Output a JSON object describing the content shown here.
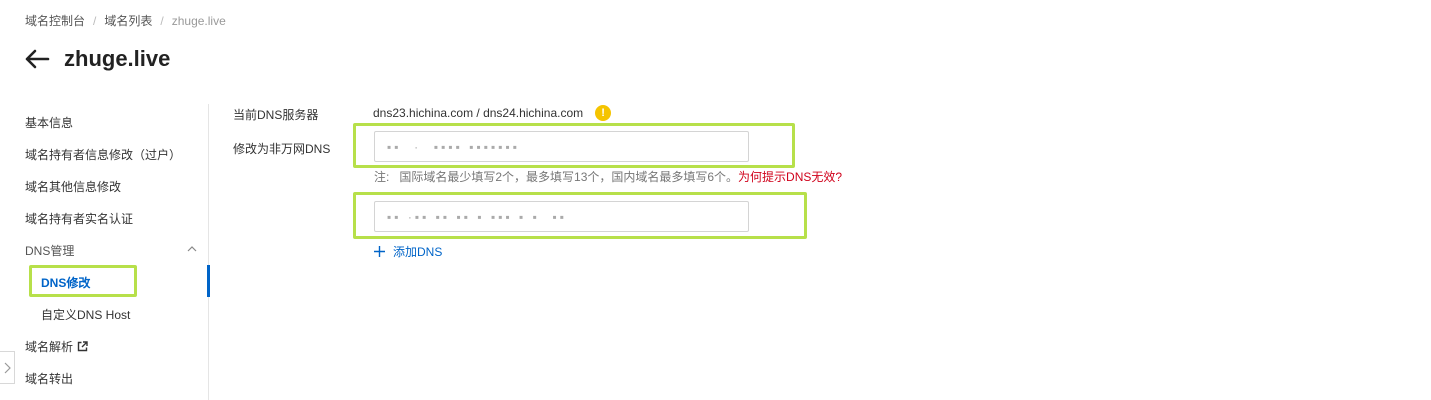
{
  "breadcrumb": {
    "items": [
      "域名控制台",
      "域名列表",
      "zhuge.live"
    ],
    "separator": "/"
  },
  "header": {
    "title": "zhuge.live"
  },
  "sidebar": {
    "items": [
      {
        "label": "基本信息"
      },
      {
        "label": "域名持有者信息修改（过户）"
      },
      {
        "label": "域名其他信息修改"
      },
      {
        "label": "域名持有者实名认证"
      },
      {
        "label": "DNS管理"
      },
      {
        "label": "DNS修改",
        "active": true
      },
      {
        "label": "自定义DNS Host"
      },
      {
        "label": "域名解析"
      },
      {
        "label": "域名转出"
      }
    ]
  },
  "form": {
    "current_dns_label": "当前DNS服务器",
    "current_dns_value": "dns23.hichina.com / dns24.hichina.com",
    "warning_icon": "!",
    "change_dns_label": "修改为非万网DNS",
    "dns_inputs": [
      {
        "value": "▪▪  ·  ▪▪▪▪ ▪▪▪▪▪▪▪"
      },
      {
        "value": "▪▪ ·▪▪ ▪▪ ▪▪ ▪ ▪▪▪ ▪ ▪  ▪▪"
      }
    ],
    "note_prefix": "注:",
    "note_text": "国际域名最少填写2个，最多填写13个，国内域名最多填写6个。",
    "note_link": "为何提示DNS无效?",
    "add_label": "添加DNS"
  },
  "colors": {
    "accent": "#0064c8",
    "highlight": "#b7e04a",
    "warning": "#f5c400",
    "link_red": "#d0021b"
  }
}
